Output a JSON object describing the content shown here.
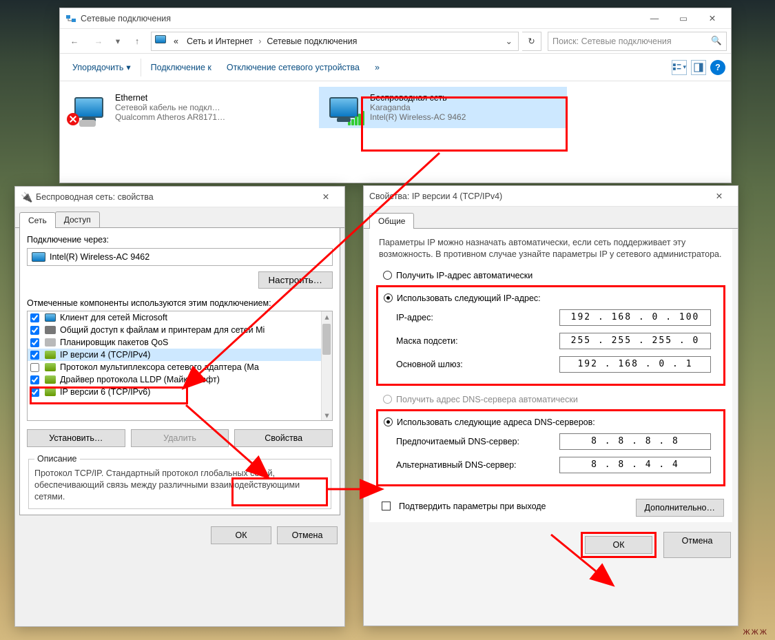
{
  "desktop_label": "",
  "explorer": {
    "title": "Сетевые подключения",
    "breadcrumb": {
      "pre": "«",
      "a": "Сеть и Интернет",
      "b": "Сетевые подключения"
    },
    "search_placeholder": "Поиск: Сетевые подключения",
    "cmds": {
      "org": "Упорядочить",
      "conn": "Подключение к",
      "disable": "Отключение сетевого устройства",
      "more": "»"
    },
    "eth": {
      "name": "Ethernet",
      "status": "Сетевой кабель не подкл…",
      "nic": "Qualcomm Atheros AR8171…"
    },
    "wifi": {
      "name": "Беспроводная сеть",
      "ssid": "Karaganda",
      "nic": "Intel(R) Wireless-AC 9462"
    }
  },
  "prop1": {
    "title": "Беспроводная сеть: свойства",
    "tabs": {
      "net": "Сеть",
      "access": "Доступ"
    },
    "conn_label": "Подключение через:",
    "adapter": "Intel(R) Wireless-AC 9462",
    "configure": "Настроить…",
    "list_label": "Отмеченные компоненты используются этим подключением:",
    "items": [
      "Клиент для сетей Microsoft",
      "Общий доступ к файлам и принтерам для сетей Mi",
      "Планировщик пакетов QoS",
      "IP версии 4 (TCP/IPv4)",
      "Протокол мультиплексора сетевого адаптера (Ма",
      "Драйвер протокола LLDP (Майкрософт)",
      "IP версии 6 (TCP/IPv6)"
    ],
    "install": "Установить…",
    "remove": "Удалить",
    "props": "Свойства",
    "desc_h": "Описание",
    "desc": "Протокол TCP/IP. Стандартный протокол глобальных сетей, обеспечивающий связь между различными взаимодействующими сетями.",
    "ok": "ОК",
    "cancel": "Отмена"
  },
  "ipv4": {
    "title": "Свойства: IP версии 4 (TCP/IPv4)",
    "tab": "Общие",
    "intro": "Параметры IP можно назначать автоматически, если сеть поддерживает эту возможность. В противном случае узнайте параметры IP у сетевого администратора.",
    "auto_ip": "Получить IP-адрес автоматически",
    "use_ip": "Использовать следующий IP-адрес:",
    "ip_lbl": "IP-адрес:",
    "ip_val": "192 . 168 .  0  . 100",
    "mask_lbl": "Маска подсети:",
    "mask_val": "255 . 255 . 255 .  0",
    "gw_lbl": "Основной шлюз:",
    "gw_val": "192 . 168 .  0  .  1",
    "auto_dns": "Получить адрес DNS-сервера автоматически",
    "use_dns": "Использовать следующие адреса DNS-серверов:",
    "dns1_lbl": "Предпочитаемый DNS-сервер:",
    "dns1_val": "8  .  8  .  8  .  8",
    "dns2_lbl": "Альтернативный DNS-сервер:",
    "dns2_val": "8  .  8  .  4  .  4",
    "confirm": "Подтвердить параметры при выходе",
    "advanced": "Дополнительно…",
    "ok": "ОК",
    "cancel": "Отмена"
  },
  "footer": "ЖЖЖ"
}
